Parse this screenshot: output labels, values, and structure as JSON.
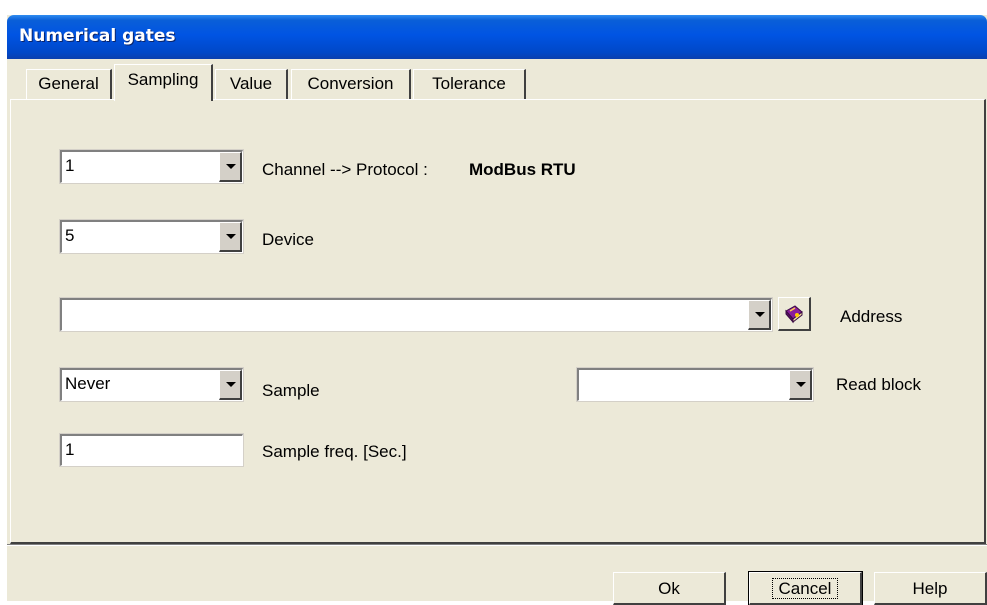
{
  "window": {
    "title": "Numerical gates"
  },
  "tabs": [
    {
      "label": "General"
    },
    {
      "label": "Sampling",
      "active": true
    },
    {
      "label": "Value"
    },
    {
      "label": "Conversion"
    },
    {
      "label": "Tolerance"
    }
  ],
  "sampling": {
    "channel": {
      "value": "1",
      "label": "Channel --> Protocol :",
      "protocol": "ModBus RTU"
    },
    "device": {
      "value": "5",
      "label": "Device"
    },
    "address": {
      "value": "",
      "label": "Address",
      "icon": "address-book-icon"
    },
    "sample": {
      "value": "Never",
      "label": "Sample"
    },
    "read_block": {
      "value": "",
      "label": "Read block"
    },
    "sample_freq": {
      "value": "1",
      "label": "Sample freq. [Sec.]"
    }
  },
  "buttons": {
    "ok": "Ok",
    "cancel": "Cancel",
    "help": "Help"
  },
  "colors": {
    "titlebar": "#0054e3",
    "face": "#ece9d8"
  }
}
